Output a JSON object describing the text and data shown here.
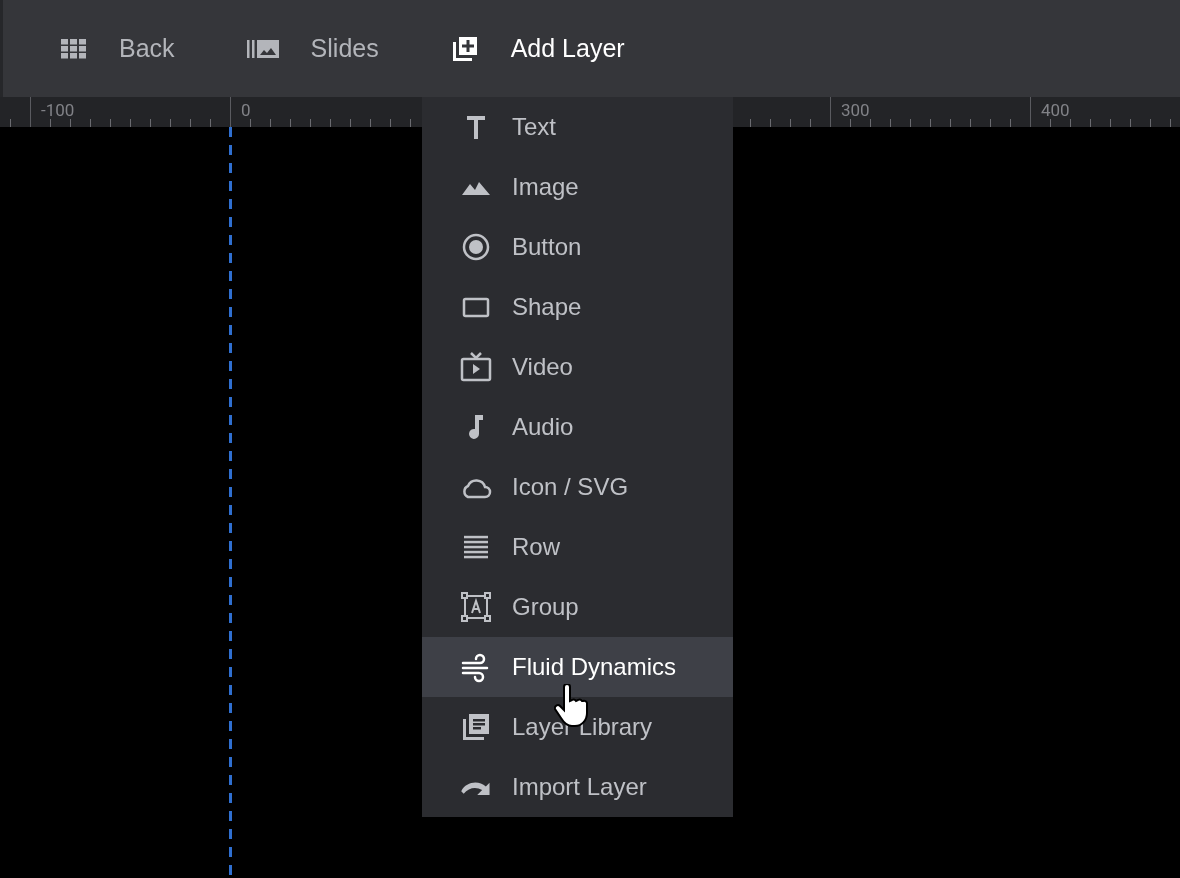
{
  "toolbar": {
    "items": [
      {
        "kind": "grid",
        "label": "Back",
        "selected": false
      },
      {
        "kind": "slides",
        "label": "Slides",
        "selected": false
      },
      {
        "kind": "add",
        "label": "Add Layer",
        "selected": true
      }
    ]
  },
  "ruler": {
    "marks": [
      "-100",
      "0",
      "300",
      "400"
    ]
  },
  "menu": {
    "items": [
      {
        "kind": "text",
        "label": "Text",
        "selected": false
      },
      {
        "kind": "image",
        "label": "Image",
        "selected": false
      },
      {
        "kind": "button",
        "label": "Button",
        "selected": false
      },
      {
        "kind": "shape",
        "label": "Shape",
        "selected": false
      },
      {
        "kind": "video",
        "label": "Video",
        "selected": false
      },
      {
        "kind": "audio",
        "label": "Audio",
        "selected": false
      },
      {
        "kind": "cloud",
        "label": "Icon / SVG",
        "selected": false
      },
      {
        "kind": "row",
        "label": "Row",
        "selected": false
      },
      {
        "kind": "group",
        "label": "Group",
        "selected": false
      },
      {
        "kind": "wind",
        "label": "Fluid Dynamics",
        "selected": true
      },
      {
        "kind": "library",
        "label": "Layer Library",
        "selected": false
      },
      {
        "kind": "import",
        "label": "Import Layer",
        "selected": false
      }
    ]
  }
}
